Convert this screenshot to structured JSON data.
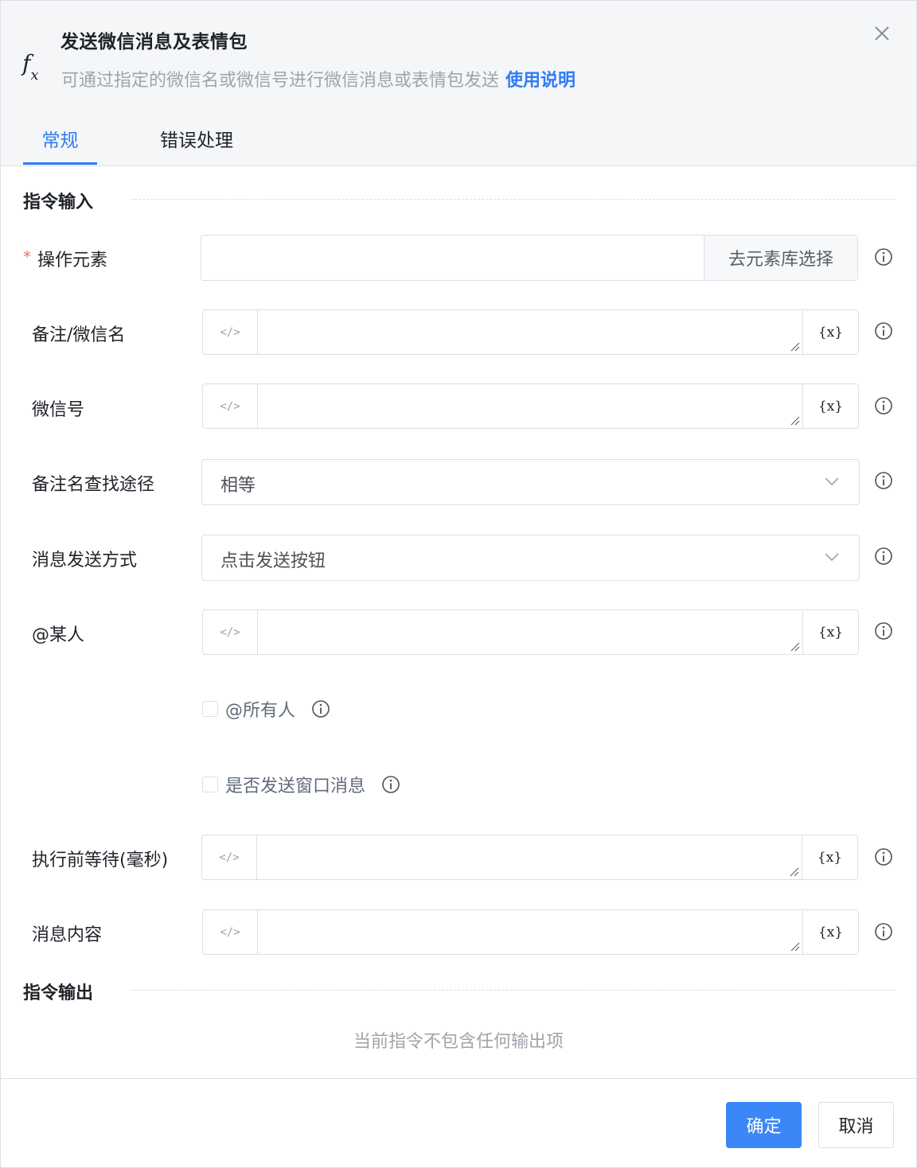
{
  "header": {
    "title": "发送微信消息及表情包",
    "subtitle": "可通过指定的微信名或微信号进行微信消息或表情包发送",
    "help_link": "使用说明",
    "icon": "fx-icon",
    "close_icon": "close-icon"
  },
  "tabs": [
    {
      "label": "常规",
      "active": true
    },
    {
      "label": "错误处理",
      "active": false
    }
  ],
  "sections": {
    "input_title": "指令输入",
    "output_title": "指令输出",
    "output_empty": "当前指令不包含任何输出项"
  },
  "fields": {
    "element": {
      "label": "操作元素",
      "required_mark": "*",
      "value": "",
      "picker_label": "去元素库选择"
    },
    "remark": {
      "label": "备注/微信名",
      "value": ""
    },
    "wechat_id": {
      "label": "微信号",
      "value": ""
    },
    "search_mode": {
      "label": "备注名查找途径",
      "value": "相等"
    },
    "send_mode": {
      "label": "消息发送方式",
      "value": "点击发送按钮"
    },
    "mention": {
      "label": "@某人",
      "value": ""
    },
    "mention_all": {
      "label": "@所有人",
      "checked": false
    },
    "window_msg": {
      "label": "是否发送窗口消息",
      "checked": false
    },
    "wait_before": {
      "label": "执行前等待(毫秒)",
      "value": ""
    },
    "message": {
      "label": "消息内容",
      "value": ""
    }
  },
  "icons": {
    "code": "</>",
    "variable": "{x}"
  },
  "footer": {
    "ok_label": "确定",
    "cancel_label": "取消"
  },
  "colors": {
    "accent": "#2f7cf6",
    "primary_button": "#3b87f7",
    "required": "#f56c6c"
  }
}
